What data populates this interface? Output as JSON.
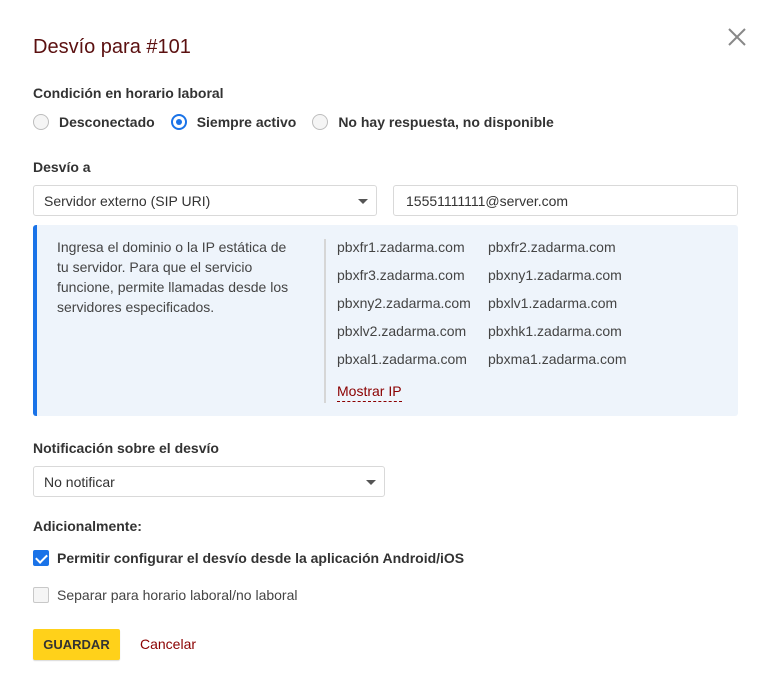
{
  "dialog": {
    "title": "Desvío para #101",
    "close_icon": "close-icon"
  },
  "working_hours": {
    "label": "Condición en horario laboral",
    "options": [
      {
        "label": "Desconectado",
        "checked": false
      },
      {
        "label": "Siempre activo",
        "checked": true
      },
      {
        "label": "No hay respuesta, no disponible",
        "checked": false
      }
    ]
  },
  "forwarding": {
    "label": "Desvío a",
    "type_selected": "Servidor externo (SIP URI)",
    "destination_value": "15551111111@server.com"
  },
  "info": {
    "text": "Ingresa el dominio o la IP estática de tu servidor. Para que el servicio funcione, permite llamadas desde los servidores especificados.",
    "servers": [
      "pbxfr1.zadarma.com",
      "pbxfr2.zadarma.com",
      "pbxfr3.zadarma.com",
      "pbxny1.zadarma.com",
      "pbxny2.zadarma.com",
      "pbxlv1.zadarma.com",
      "pbxlv2.zadarma.com",
      "pbxhk1.zadarma.com",
      "pbxal1.zadarma.com",
      "pbxma1.zadarma.com"
    ],
    "show_ip_label": "Mostrar IP"
  },
  "notification": {
    "label": "Notificación sobre el desvío",
    "selected": "No notificar"
  },
  "additional": {
    "label": "Adicionalmente:",
    "options": [
      {
        "label": "Permitir configurar el desvío desde la aplicación Android/iOS",
        "checked": true
      },
      {
        "label": "Separar para horario laboral/no laboral",
        "checked": false
      }
    ]
  },
  "actions": {
    "save_label": "GUARDAR",
    "cancel_label": "Cancelar"
  },
  "colors": {
    "accent": "#1a73e8",
    "title": "#5b1010",
    "link": "#8b0000",
    "save_button": "#ffd11a",
    "info_background": "#eef4fb"
  }
}
